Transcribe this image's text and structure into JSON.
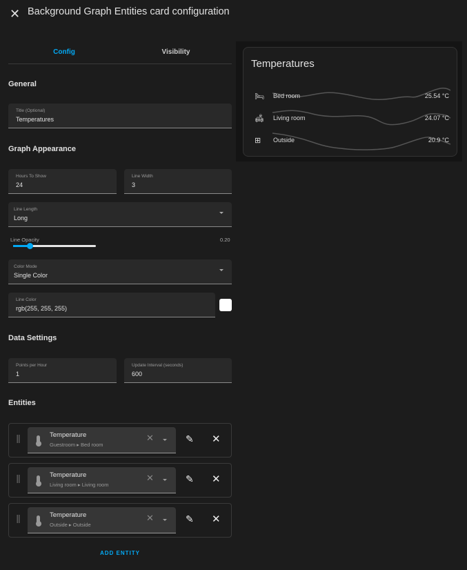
{
  "header": {
    "title": "Background Graph Entities card configuration"
  },
  "tabs": [
    "Config",
    "Visibility"
  ],
  "general": {
    "heading": "General",
    "title_label": "Title (Optional)",
    "title_value": "Temperatures"
  },
  "appearance": {
    "heading": "Graph Appearance",
    "hours_label": "Hours To Show",
    "hours_value": "24",
    "width_label": "Line Width",
    "width_value": "3",
    "length_label": "Line Length",
    "length_value": "Long",
    "opacity_label": "Line Opacity",
    "opacity_value": "0.20",
    "opacity_fraction": 0.2,
    "color_mode_label": "Color Mode",
    "color_mode_value": "Single Color",
    "line_color_label": "Line Color",
    "line_color_value": "rgb(255, 255, 255)",
    "swatch_color": "#ffffff"
  },
  "data_settings": {
    "heading": "Data Settings",
    "points_label": "Points per Hour",
    "points_value": "1",
    "interval_label": "Update Interval (seconds)",
    "interval_value": "600"
  },
  "entities": {
    "heading": "Entities",
    "add_label": "ADD ENTITY",
    "items": [
      {
        "name": "Temperature",
        "area": "Guestroom ▸ Bed room"
      },
      {
        "name": "Temperature",
        "area": "Living room ▸ Living room"
      },
      {
        "name": "Temperature",
        "area": "Outside ▸ Outside"
      }
    ]
  },
  "preview": {
    "title": "Temperatures",
    "rows": [
      {
        "icon": "bed-icon",
        "name": "Bed room",
        "value": "25.54 °C"
      },
      {
        "icon": "sofa-icon",
        "name": "Living room",
        "value": "24.07 °C"
      },
      {
        "icon": "window-icon",
        "name": "Outside",
        "value": "20.9 °C"
      }
    ]
  },
  "accent": "#03a9f4"
}
